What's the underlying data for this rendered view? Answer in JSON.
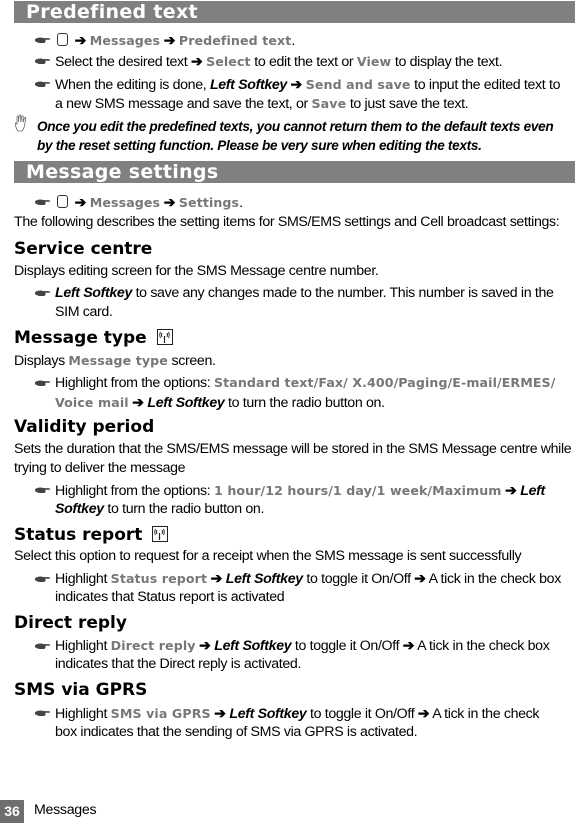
{
  "sections": {
    "predefined": {
      "title": "Predefined text",
      "nav": {
        "messages": "Messages",
        "target": "Predefined text",
        "end": "."
      },
      "step2": {
        "pre": "Select the desired text",
        "select": "Select",
        "mid": "to edit the text or",
        "view": "View",
        "post": "to display the text."
      },
      "step3": {
        "pre": "When the editing is done,",
        "softkey": "Left Softkey",
        "send": "Send and save",
        "post": "to input the edited text to",
        "line2pre": "a new SMS message and save the text, or",
        "save": "Save",
        "line2post": "to just save the text."
      },
      "note": {
        "line1": "Once you edit the predefined texts, you cannot return them to the default texts even",
        "line2": "by the reset setting function. Please be very sure when editing the texts."
      }
    },
    "settings": {
      "title": "Message settings",
      "nav": {
        "messages": "Messages",
        "target": "Settings",
        "end": "."
      },
      "intro": "The following describes the setting items for SMS/EMS settings and Cell broadcast settings:"
    }
  },
  "items": {
    "service_centre": {
      "heading": "Service centre",
      "desc": "Displays editing screen for the SMS Message centre number.",
      "softkey": "Left Softkey",
      "bullet": "to save any changes made to the number. This number is saved in the",
      "bullet2": "SIM card."
    },
    "message_type": {
      "heading": "Message type",
      "desc_pre": "Displays",
      "desc_hl": "Message type",
      "desc_post": "screen.",
      "bullet_pre": "Highlight from the options:",
      "options": "Standard text/Fax/ X.400/Paging/E-mail/ERMES/",
      "options2": "Voice mail",
      "softkey": "Left Softkey",
      "bullet_post": "to turn the radio button on."
    },
    "validity": {
      "heading": "Validity period",
      "desc1": "Sets the duration that the SMS/EMS message will be stored in the SMS Message centre while",
      "desc2": "trying to deliver the message",
      "bullet_pre": "Highlight from the options:",
      "options": "1 hour/12 hours/1 day/1 week/Maximum",
      "softkey_a": "Left",
      "softkey_b": "Softkey",
      "bullet_post": "to turn the radio button on."
    },
    "status_report": {
      "heading": "Status report",
      "desc": "Select this option to request for a receipt when the SMS message is sent successfully",
      "bullet_pre": "Highlight",
      "hl": "Status report",
      "softkey": "Left Softkey",
      "mid": "to toggle it On/Off",
      "post": "A tick in the check box",
      "line2": "indicates that Status report is activated"
    },
    "direct_reply": {
      "heading": "Direct reply",
      "bullet_pre": "Highlight",
      "hl": "Direct reply",
      "softkey": "Left Softkey",
      "mid": "to toggle it On/Off",
      "post": "A tick in the check box",
      "line2": "indicates that the Direct reply is activated."
    },
    "sms_gprs": {
      "heading": "SMS via GPRS",
      "bullet_pre": "Highlight",
      "hl": "SMS via GPRS",
      "softkey": "Left Softkey",
      "mid": "to toggle it On/Off",
      "post": "A tick in the check",
      "line2": "box indicates that the sending of SMS via GPRS is activated."
    }
  },
  "footer": {
    "page_number": "36",
    "chapter": "Messages"
  },
  "symbols": {
    "arrow": "➔"
  }
}
